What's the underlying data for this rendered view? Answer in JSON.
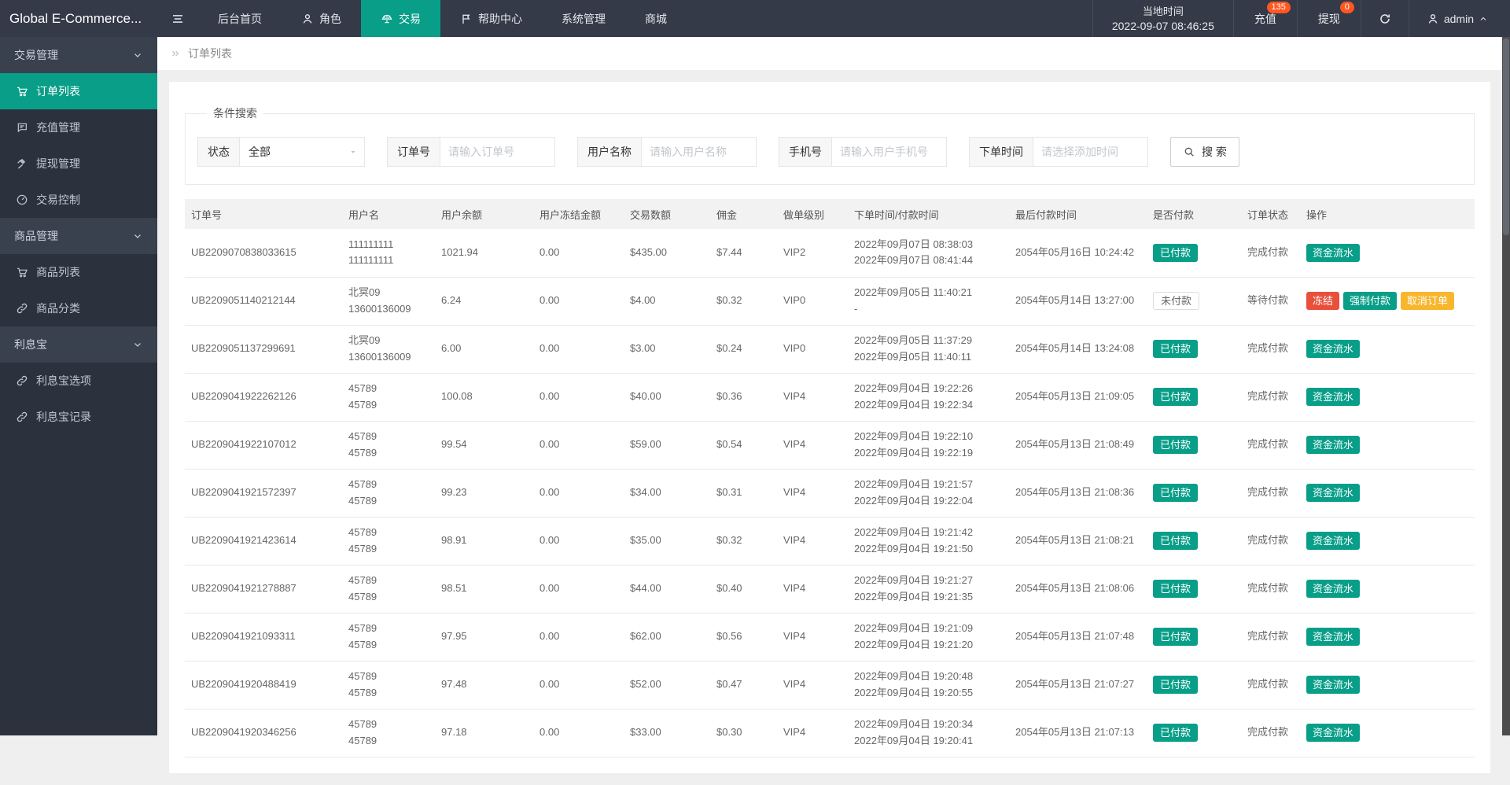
{
  "colors": {
    "accent_teal": "#089e88",
    "danger_red": "#e8503a",
    "warning_orange": "#f8b62d",
    "notification_badge": "#ff5722",
    "topbar_bg": "#343a47",
    "sidebar_bg": "#2b323d"
  },
  "topbar": {
    "logo": "Global E-Commerce...",
    "nav": [
      {
        "name": "backend-home",
        "label": "后台首页"
      },
      {
        "name": "roles",
        "label": "角色",
        "icon": "person"
      },
      {
        "name": "trade",
        "label": "交易",
        "icon": "scales",
        "active": true
      },
      {
        "name": "help-center",
        "label": "帮助中心",
        "icon": "flag"
      },
      {
        "name": "system-management",
        "label": "系统管理"
      },
      {
        "name": "mall",
        "label": "商城"
      }
    ],
    "time_label": "当地时间",
    "time_value": "2022-09-07 08:46:25",
    "recharge": {
      "label": "充值",
      "badge": "135"
    },
    "withdraw": {
      "label": "提现",
      "badge": "0"
    },
    "admin_name": "admin"
  },
  "sidebar": {
    "groups": [
      {
        "name": "trade-management",
        "label": "交易管理",
        "items": [
          {
            "name": "order-list",
            "label": "订单列表",
            "icon": "cart",
            "active": true
          },
          {
            "name": "recharge-management",
            "label": "充值管理",
            "icon": "comment"
          },
          {
            "name": "withdraw-management",
            "label": "提现管理",
            "icon": "gavel"
          },
          {
            "name": "trade-control",
            "label": "交易控制",
            "icon": "gauge"
          }
        ]
      },
      {
        "name": "product-management",
        "label": "商品管理",
        "items": [
          {
            "name": "product-list",
            "label": "商品列表",
            "icon": "cart"
          },
          {
            "name": "product-category",
            "label": "商品分类",
            "icon": "link"
          }
        ]
      },
      {
        "name": "interest-treasure",
        "label": "利息宝",
        "items": [
          {
            "name": "interest-options",
            "label": "利息宝选项",
            "icon": "link"
          },
          {
            "name": "interest-records",
            "label": "利息宝记录",
            "icon": "link"
          }
        ]
      }
    ]
  },
  "breadcrumb": {
    "title": "订单列表"
  },
  "search": {
    "legend": "条件搜索",
    "status": {
      "label": "状态",
      "value": "全部"
    },
    "fields": [
      {
        "name": "order-no",
        "label": "订单号",
        "placeholder": "请输入订单号"
      },
      {
        "name": "user-name",
        "label": "用户名称",
        "placeholder": "请输入用户名称"
      },
      {
        "name": "phone",
        "label": "手机号",
        "placeholder": "请输入用户手机号"
      },
      {
        "name": "order-time",
        "label": "下单时间",
        "placeholder": "请选择添加时间"
      }
    ],
    "button_label": "搜 索"
  },
  "table": {
    "columns": [
      "订单号",
      "用户名",
      "用户余额",
      "用户冻结金额",
      "交易数额",
      "佣金",
      "做单级别",
      "下单时间/付款时间",
      "最后付款时间",
      "是否付款",
      "订单状态",
      "操作"
    ],
    "rows": [
      {
        "order_no": "UB2209070838033615",
        "user_lines": [
          "111111111",
          "111111111"
        ],
        "balance": "1021.94",
        "frozen": "0.00",
        "amount": "$435.00",
        "commission": "$7.44",
        "level": "VIP2",
        "time_lines": [
          "2022年09月07日 08:38:03",
          "2022年09月07日 08:41:44"
        ],
        "last_pay_time": "2054年05月16日 10:24:42",
        "payment": {
          "label": "已付款",
          "state": "paid"
        },
        "status": "完成付款",
        "actions": [
          {
            "name": "funds-flow-button",
            "label": "资金流水",
            "style": "teal"
          }
        ]
      },
      {
        "order_no": "UB2209051140212144",
        "user_lines": [
          "北冥09",
          "13600136009"
        ],
        "balance": "6.24",
        "frozen": "0.00",
        "amount": "$4.00",
        "commission": "$0.32",
        "level": "VIP0",
        "time_lines": [
          "2022年09月05日 11:40:21",
          "-"
        ],
        "last_pay_time": "2054年05月14日 13:27:00",
        "payment": {
          "label": "未付款",
          "state": "unpaid"
        },
        "status": "等待付款",
        "actions": [
          {
            "name": "freeze-button",
            "label": "冻结",
            "style": "red"
          },
          {
            "name": "force-pay-button",
            "label": "强制付款",
            "style": "teal"
          },
          {
            "name": "cancel-order-button",
            "label": "取消订单",
            "style": "orange"
          }
        ]
      },
      {
        "order_no": "UB2209051137299691",
        "user_lines": [
          "北冥09",
          "13600136009"
        ],
        "balance": "6.00",
        "frozen": "0.00",
        "amount": "$3.00",
        "commission": "$0.24",
        "level": "VIP0",
        "time_lines": [
          "2022年09月05日 11:37:29",
          "2022年09月05日 11:40:11"
        ],
        "last_pay_time": "2054年05月14日 13:24:08",
        "payment": {
          "label": "已付款",
          "state": "paid"
        },
        "status": "完成付款",
        "actions": [
          {
            "name": "funds-flow-button",
            "label": "资金流水",
            "style": "teal"
          }
        ]
      },
      {
        "order_no": "UB2209041922262126",
        "user_lines": [
          "45789",
          "45789"
        ],
        "balance": "100.08",
        "frozen": "0.00",
        "amount": "$40.00",
        "commission": "$0.36",
        "level": "VIP4",
        "time_lines": [
          "2022年09月04日 19:22:26",
          "2022年09月04日 19:22:34"
        ],
        "last_pay_time": "2054年05月13日 21:09:05",
        "payment": {
          "label": "已付款",
          "state": "paid"
        },
        "status": "完成付款",
        "actions": [
          {
            "name": "funds-flow-button",
            "label": "资金流水",
            "style": "teal"
          }
        ]
      },
      {
        "order_no": "UB2209041922107012",
        "user_lines": [
          "45789",
          "45789"
        ],
        "balance": "99.54",
        "frozen": "0.00",
        "amount": "$59.00",
        "commission": "$0.54",
        "level": "VIP4",
        "time_lines": [
          "2022年09月04日 19:22:10",
          "2022年09月04日 19:22:19"
        ],
        "last_pay_time": "2054年05月13日 21:08:49",
        "payment": {
          "label": "已付款",
          "state": "paid"
        },
        "status": "完成付款",
        "actions": [
          {
            "name": "funds-flow-button",
            "label": "资金流水",
            "style": "teal"
          }
        ]
      },
      {
        "order_no": "UB2209041921572397",
        "user_lines": [
          "45789",
          "45789"
        ],
        "balance": "99.23",
        "frozen": "0.00",
        "amount": "$34.00",
        "commission": "$0.31",
        "level": "VIP4",
        "time_lines": [
          "2022年09月04日 19:21:57",
          "2022年09月04日 19:22:04"
        ],
        "last_pay_time": "2054年05月13日 21:08:36",
        "payment": {
          "label": "已付款",
          "state": "paid"
        },
        "status": "完成付款",
        "actions": [
          {
            "name": "funds-flow-button",
            "label": "资金流水",
            "style": "teal"
          }
        ]
      },
      {
        "order_no": "UB2209041921423614",
        "user_lines": [
          "45789",
          "45789"
        ],
        "balance": "98.91",
        "frozen": "0.00",
        "amount": "$35.00",
        "commission": "$0.32",
        "level": "VIP4",
        "time_lines": [
          "2022年09月04日 19:21:42",
          "2022年09月04日 19:21:50"
        ],
        "last_pay_time": "2054年05月13日 21:08:21",
        "payment": {
          "label": "已付款",
          "state": "paid"
        },
        "status": "完成付款",
        "actions": [
          {
            "name": "funds-flow-button",
            "label": "资金流水",
            "style": "teal"
          }
        ]
      },
      {
        "order_no": "UB2209041921278887",
        "user_lines": [
          "45789",
          "45789"
        ],
        "balance": "98.51",
        "frozen": "0.00",
        "amount": "$44.00",
        "commission": "$0.40",
        "level": "VIP4",
        "time_lines": [
          "2022年09月04日 19:21:27",
          "2022年09月04日 19:21:35"
        ],
        "last_pay_time": "2054年05月13日 21:08:06",
        "payment": {
          "label": "已付款",
          "state": "paid"
        },
        "status": "完成付款",
        "actions": [
          {
            "name": "funds-flow-button",
            "label": "资金流水",
            "style": "teal"
          }
        ]
      },
      {
        "order_no": "UB2209041921093311",
        "user_lines": [
          "45789",
          "45789"
        ],
        "balance": "97.95",
        "frozen": "0.00",
        "amount": "$62.00",
        "commission": "$0.56",
        "level": "VIP4",
        "time_lines": [
          "2022年09月04日 19:21:09",
          "2022年09月04日 19:21:20"
        ],
        "last_pay_time": "2054年05月13日 21:07:48",
        "payment": {
          "label": "已付款",
          "state": "paid"
        },
        "status": "完成付款",
        "actions": [
          {
            "name": "funds-flow-button",
            "label": "资金流水",
            "style": "teal"
          }
        ]
      },
      {
        "order_no": "UB2209041920488419",
        "user_lines": [
          "45789",
          "45789"
        ],
        "balance": "97.48",
        "frozen": "0.00",
        "amount": "$52.00",
        "commission": "$0.47",
        "level": "VIP4",
        "time_lines": [
          "2022年09月04日 19:20:48",
          "2022年09月04日 19:20:55"
        ],
        "last_pay_time": "2054年05月13日 21:07:27",
        "payment": {
          "label": "已付款",
          "state": "paid"
        },
        "status": "完成付款",
        "actions": [
          {
            "name": "funds-flow-button",
            "label": "资金流水",
            "style": "teal"
          }
        ]
      },
      {
        "order_no": "UB2209041920346256",
        "user_lines": [
          "45789",
          "45789"
        ],
        "balance": "97.18",
        "frozen": "0.00",
        "amount": "$33.00",
        "commission": "$0.30",
        "level": "VIP4",
        "time_lines": [
          "2022年09月04日 19:20:34",
          "2022年09月04日 19:20:41"
        ],
        "last_pay_time": "2054年05月13日 21:07:13",
        "payment": {
          "label": "已付款",
          "state": "paid"
        },
        "status": "完成付款",
        "actions": [
          {
            "name": "funds-flow-button",
            "label": "资金流水",
            "style": "teal"
          }
        ]
      }
    ]
  }
}
